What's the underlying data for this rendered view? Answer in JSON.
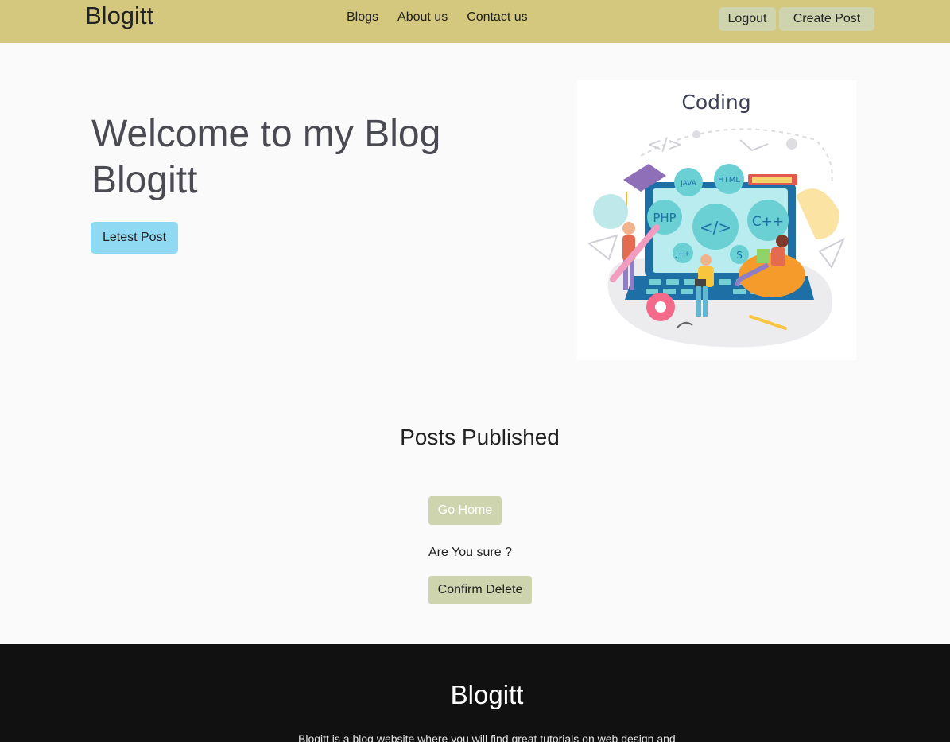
{
  "navbar": {
    "brand": "Blogitt",
    "links": [
      "Blogs",
      "About us",
      "Contact us"
    ],
    "logout_label": "Logout",
    "create_label": "Create Post"
  },
  "hero": {
    "title": "Welcome to my Blog Blogitt",
    "button_label": "Letest Post",
    "image": {
      "heading": "Coding",
      "bubbles": [
        "JAVA",
        "HTML",
        "PHP",
        "</>",
        "C++",
        "J++",
        "S"
      ],
      "tag": "</>"
    }
  },
  "posts": {
    "title": "Posts Published",
    "home_label": "Go Home",
    "confirm_text": "Are You sure ?",
    "delete_label": "Confirm Delete"
  },
  "footer": {
    "brand": "Blogitt",
    "text": "Blogitt is a blog website where you will find great tutorials on web design and"
  },
  "colors": {
    "navbar": "#d4c87e",
    "button": "#cdd4ae",
    "hero_button": "#8fd9f2",
    "footer": "#111111"
  }
}
